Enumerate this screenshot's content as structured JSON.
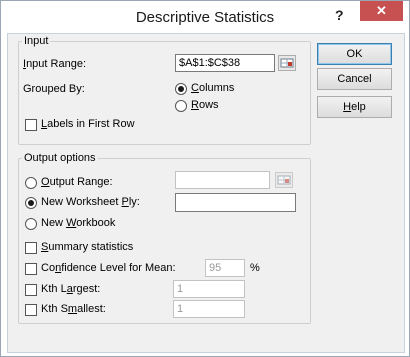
{
  "dialog": {
    "title": "Descriptive Statistics",
    "help_glyph": "?",
    "close_glyph": "✕"
  },
  "input_group": {
    "legend": "Input",
    "input_range_label": "Input Range:",
    "input_range_value": "$A$1:$C$38",
    "grouped_by_label": "Grouped By:",
    "columns_label": "Columns",
    "rows_label": "Rows",
    "grouped_by_selected": "Columns",
    "labels_first_row_label": "Labels in First Row",
    "labels_first_row_checked": false
  },
  "output_group": {
    "legend": "Output options",
    "output_range_label": "Output Range:",
    "output_range_value": "",
    "new_worksheet_label": "New Worksheet Ply:",
    "new_worksheet_value": "",
    "new_workbook_label": "New Workbook",
    "selected": "New Worksheet Ply",
    "summary_statistics_label": "Summary statistics",
    "confidence_label": "Confidence Level for Mean:",
    "confidence_value": "95",
    "percent_sign": "%",
    "kth_largest_label": "Kth Largest:",
    "kth_largest_value": "1",
    "kth_smallest_label": "Kth Smallest:",
    "kth_smallest_value": "1"
  },
  "buttons": {
    "ok": "OK",
    "cancel": "Cancel",
    "help": "Help"
  }
}
